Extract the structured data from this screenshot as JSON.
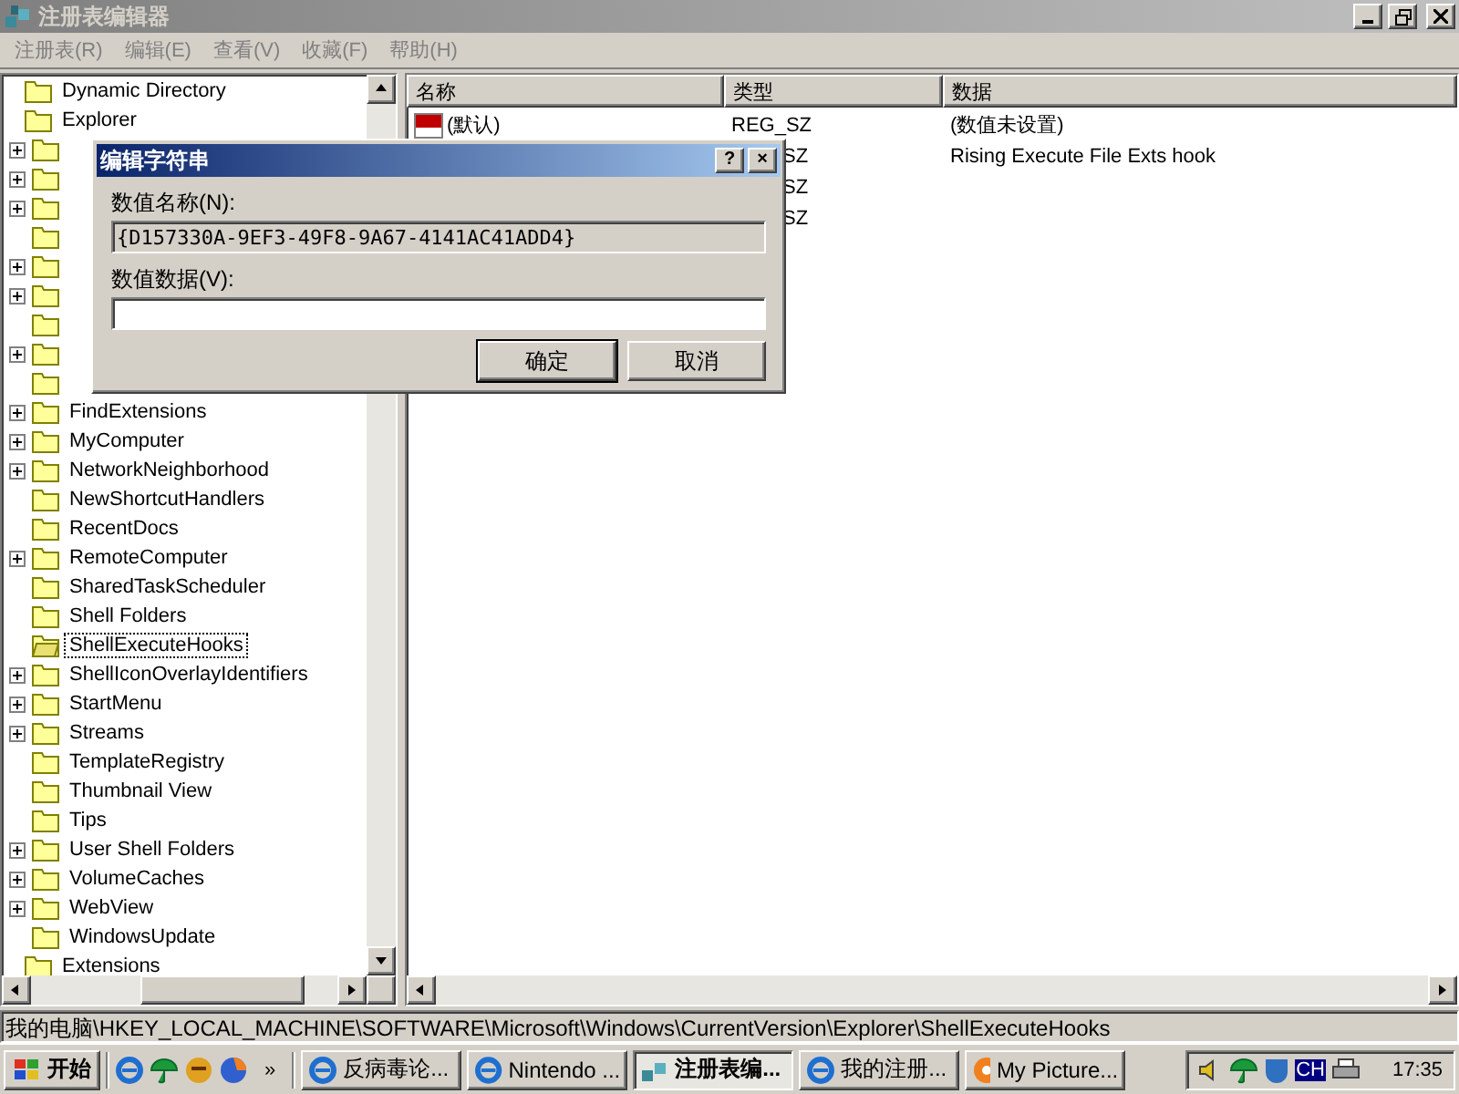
{
  "window": {
    "title": "注册表编辑器",
    "active": false
  },
  "menu": [
    "注册表(R)",
    "编辑(E)",
    "查看(V)",
    "收藏(F)",
    "帮助(H)"
  ],
  "tree": [
    {
      "label": "Dynamic Directory",
      "expandable": false
    },
    {
      "label": "Explorer",
      "expandable": false,
      "children": [
        {
          "expandable": true
        },
        {
          "expandable": true
        },
        {
          "expandable": true
        },
        {
          "expandable": false
        },
        {
          "expandable": true
        },
        {
          "expandable": true
        },
        {
          "expandable": false
        },
        {
          "expandable": true
        },
        {
          "expandable": false
        },
        {
          "label": "FindExtensions",
          "expandable": true,
          "selected": false
        },
        {
          "label": "MyComputer",
          "expandable": true,
          "selected": false
        },
        {
          "label": "NetworkNeighborhood",
          "expandable": true,
          "selected": false
        },
        {
          "label": "NewShortcutHandlers",
          "expandable": false,
          "selected": false
        },
        {
          "label": "RecentDocs",
          "expandable": false,
          "selected": false
        },
        {
          "label": "RemoteComputer",
          "expandable": true,
          "selected": false
        },
        {
          "label": "SharedTaskScheduler",
          "expandable": false,
          "selected": false
        },
        {
          "label": "Shell Folders",
          "expandable": false,
          "selected": false
        },
        {
          "label": "ShellExecuteHooks",
          "expandable": false,
          "selected": true
        },
        {
          "label": "ShellIconOverlayIdentifiers",
          "expandable": true,
          "selected": false
        },
        {
          "label": "StartMenu",
          "expandable": true,
          "selected": false
        },
        {
          "label": "Streams",
          "expandable": true,
          "selected": false
        },
        {
          "label": "TemplateRegistry",
          "expandable": false,
          "selected": false
        },
        {
          "label": "Thumbnail View",
          "expandable": false,
          "selected": false
        },
        {
          "label": "Tips",
          "expandable": false,
          "selected": false
        },
        {
          "label": "User Shell Folders",
          "expandable": true,
          "selected": false
        },
        {
          "label": "VolumeCaches",
          "expandable": true,
          "selected": false
        },
        {
          "label": "WebView",
          "expandable": true,
          "selected": false
        },
        {
          "label": "WindowsUpdate",
          "expandable": false,
          "selected": false
        }
      ]
    },
    {
      "label": "Extensions",
      "expandable": false
    }
  ],
  "list": {
    "columns": [
      "名称",
      "类型",
      "数据"
    ],
    "rows": [
      {
        "name": "(默认)",
        "type": "REG_SZ",
        "data": "(数值未设置)"
      },
      {
        "type_partial": "SZ",
        "data": "Rising Execute File Exts hook"
      },
      {
        "type_partial": "SZ"
      },
      {
        "type_partial": "SZ"
      }
    ]
  },
  "dialog": {
    "title": "编辑字符串",
    "help": "?",
    "close": "×",
    "name_label": "数值名称(N):",
    "name_value": "{D157330A-9EF3-49F8-9A67-4141AC41ADD4}",
    "data_label": "数值数据(V):",
    "buttons": [
      {
        "label": "确定",
        "default": true
      },
      {
        "label": "取消",
        "default": false
      }
    ]
  },
  "status_bar": "我的电脑\\HKEY_LOCAL_MACHINE\\SOFTWARE\\Microsoft\\Windows\\CurrentVersion\\Explorer\\ShellExecuteHooks",
  "taskbar": {
    "start": "开始",
    "more": "»",
    "tasks": [
      {
        "label": "反病毒论...",
        "selected": false,
        "kind": "ie"
      },
      {
        "label": "Nintendo ...",
        "selected": false,
        "kind": "ie"
      },
      {
        "label": "注册表编...",
        "selected": true,
        "kind": "regedit"
      },
      {
        "label": "我的注册...",
        "selected": false,
        "kind": "ie"
      },
      {
        "label": "My Picture...",
        "selected": false,
        "kind": "player"
      }
    ],
    "lang": "CH",
    "clock": "17:35"
  }
}
